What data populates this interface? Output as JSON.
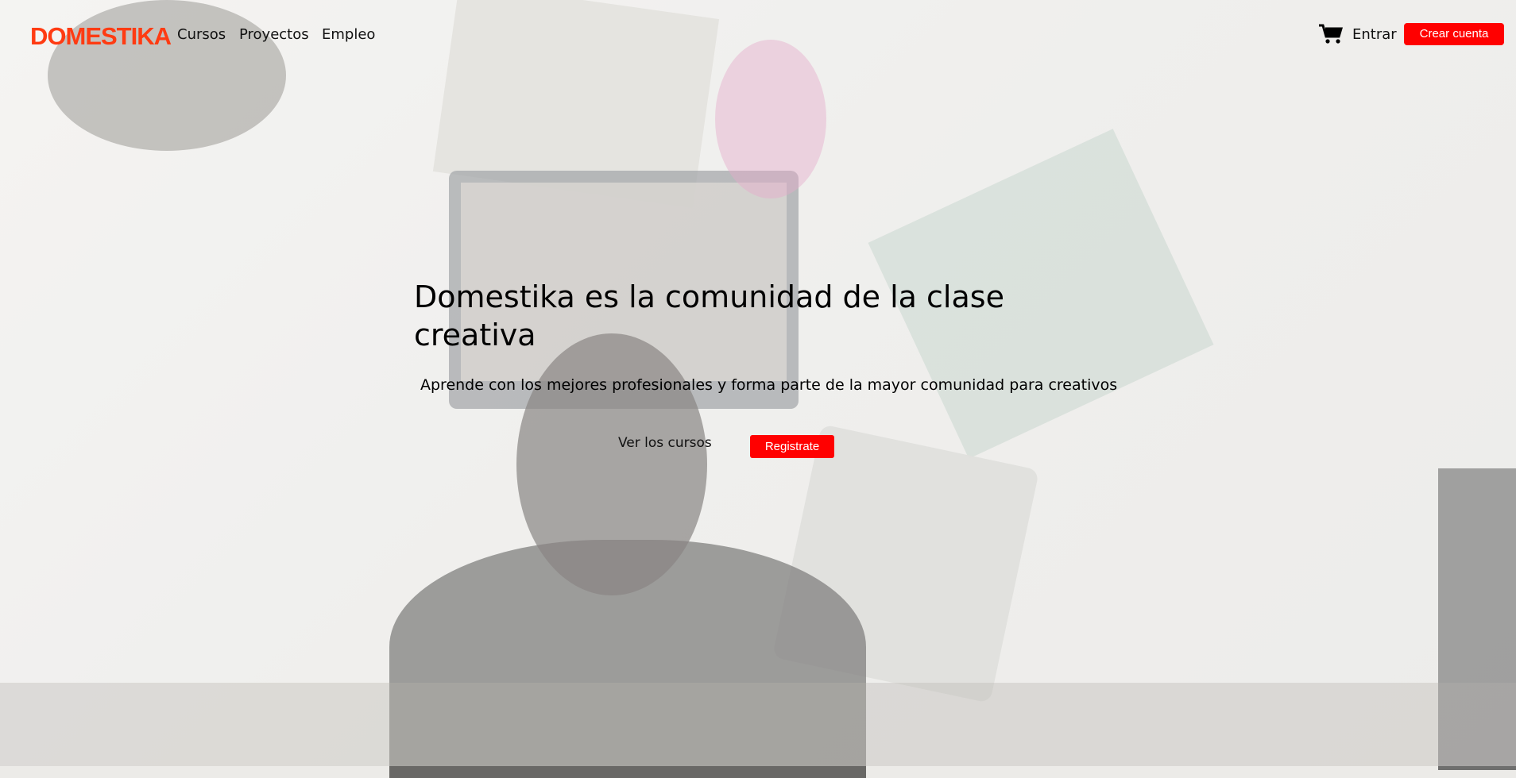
{
  "header": {
    "logo": "DOMESTIKA",
    "nav": [
      "Cursos",
      "Proyectos",
      "Empleo"
    ],
    "cart_icon": "shopping-cart-icon",
    "login_label": "Entrar",
    "signup_label": "Crear cuenta"
  },
  "hero": {
    "title": "Domestika es la comunidad de la clase creativa",
    "subtitle": "Aprende con los mejores profesionales y forma parte de la mayor comunidad para creativos",
    "courses_link": "Ver los cursos",
    "register_label": "Registrate"
  },
  "colors": {
    "brand": "#ff3b12",
    "button": "#ff0000"
  }
}
